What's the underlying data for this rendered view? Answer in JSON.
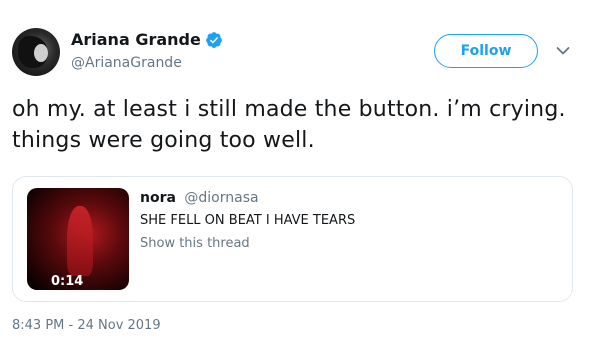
{
  "author": {
    "name": "Ariana Grande",
    "handle": "@ArianaGrande",
    "verified": true,
    "avatar_icon": "profile-photo"
  },
  "actions": {
    "follow_label": "Follow",
    "more_icon": "chevron-down-icon"
  },
  "tweet": {
    "text": "oh my. at least i still made the button. i’m crying. things were going too well.",
    "timestamp": "8:43 PM - 24 Nov 2019"
  },
  "quoted_tweet": {
    "name": "nora",
    "handle": "@diornasa",
    "text": "SHE FELL ON BEAT I HAVE TEARS",
    "thread_link": "Show this thread",
    "media_duration": "0:14"
  },
  "colors": {
    "accent": "#1da1f2",
    "text": "#14171a",
    "secondary_text": "#657786",
    "border": "#e1e8ed"
  }
}
